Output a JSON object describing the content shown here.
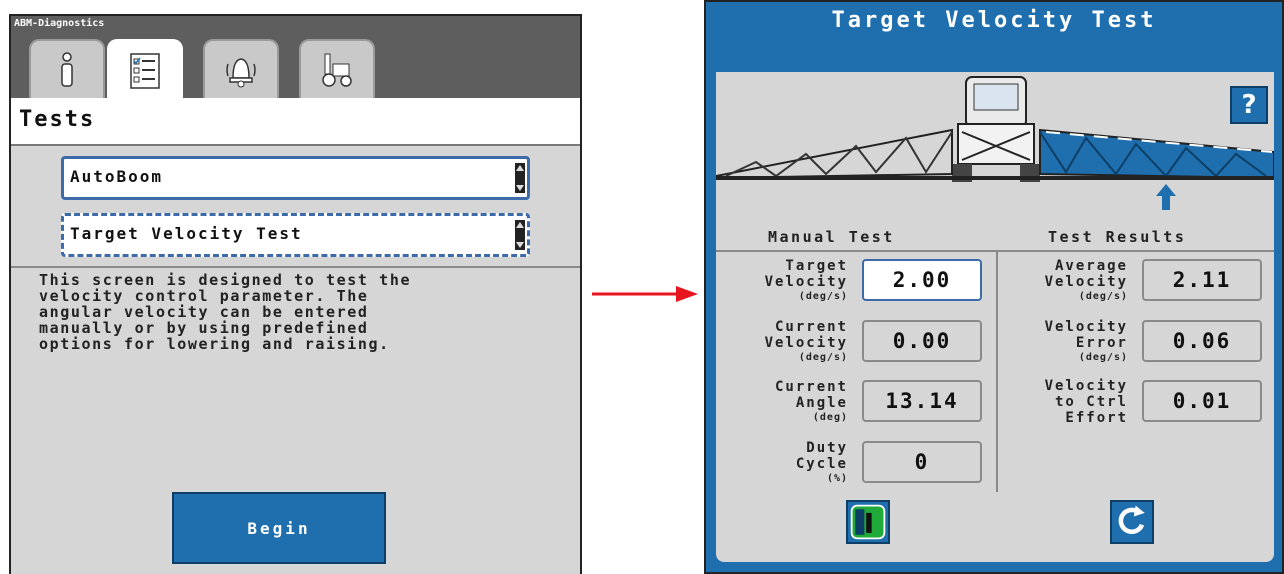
{
  "left": {
    "app_title": "ABM-Diagnostics",
    "tabs": [
      {
        "icon": "info-icon"
      },
      {
        "icon": "checklist-icon"
      },
      {
        "icon": "alarm-bell-icon"
      },
      {
        "icon": "tractor-icon"
      }
    ],
    "heading": "Tests",
    "select_1": "AutoBoom",
    "select_2": "Target Velocity Test",
    "description": "This screen is designed to test the\nvelocity control parameter. The\nangular velocity can be entered\nmanually or by using predefined\noptions for lowering and raising.",
    "begin_label": "Begin"
  },
  "right": {
    "title": "Target Velocity Test",
    "help_label": "?",
    "manual_header": "Manual Test",
    "results_header": "Test Results",
    "manual": {
      "target_velocity": {
        "label": "Target\nVelocity",
        "unit": "(deg/s)",
        "value": "2.00"
      },
      "current_velocity": {
        "label": "Current\nVelocity",
        "unit": "(deg/s)",
        "value": "0.00"
      },
      "current_angle": {
        "label": "Current\nAngle",
        "unit": "(deg)",
        "value": "13.14"
      },
      "duty_cycle": {
        "label": "Duty\nCycle",
        "unit": "(%)",
        "value": "0"
      }
    },
    "results": {
      "average_velocity": {
        "label": "Average\nVelocity",
        "unit": "(deg/s)",
        "value": "2.11"
      },
      "velocity_error": {
        "label": "Velocity\nError",
        "unit": "(deg/s)",
        "value": "0.06"
      },
      "velocity_ctrl_effort": {
        "label": "Velocity\nto Ctrl\nEffort",
        "unit": "",
        "value": "0.01"
      }
    }
  },
  "colors": {
    "accent_blue": "#1f6fae",
    "arrow_red": "#e8141e",
    "panel_gray": "#d6d6d6"
  }
}
